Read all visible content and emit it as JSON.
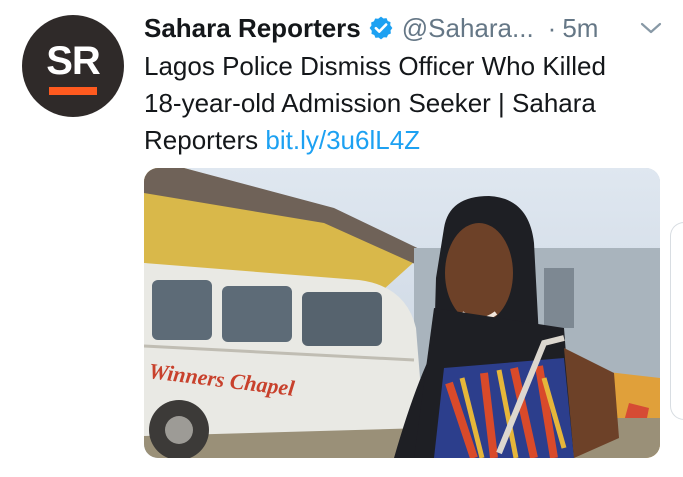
{
  "tweet": {
    "author_name": "Sahara Reporters",
    "avatar_text": "SR",
    "handle": "@Sahara...",
    "separator": "·",
    "time": "5m",
    "text_line1": "Lagos Police Dismiss Officer Who Killed",
    "text_line2": "18-year-old Admission Seeker | Sahara",
    "text_line3": "Reporters",
    "link": "bit.ly/3u6lL4Z",
    "media_bus_text": "Winners Chapel"
  },
  "colors": {
    "brand_orange": "#ff5a1f",
    "verified_blue": "#1da1f2",
    "link_blue": "#1da1f2",
    "text_gray": "#657786"
  },
  "icons": {
    "verified": "verified-badge-icon",
    "chevron": "chevron-down-icon"
  }
}
